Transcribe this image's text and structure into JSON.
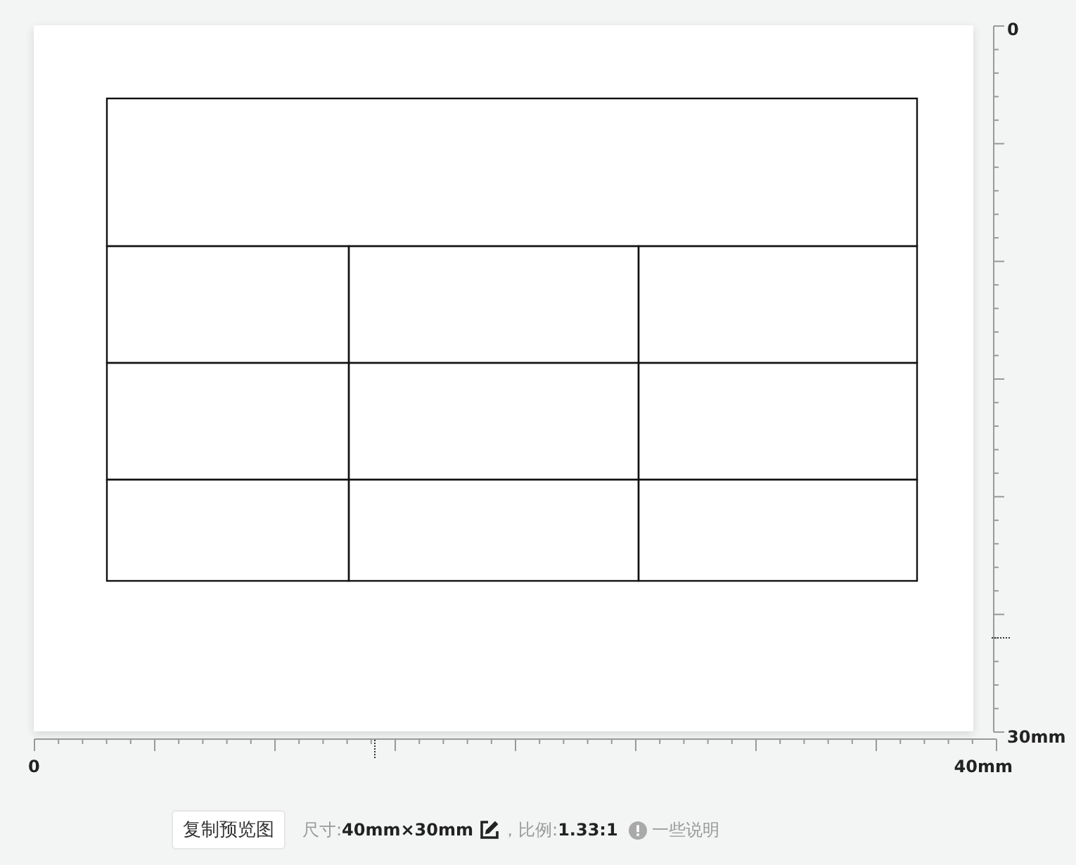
{
  "preview": {
    "table": {
      "rows": [
        {
          "kind": "full"
        },
        {
          "kind": "split"
        },
        {
          "kind": "split"
        },
        {
          "kind": "split"
        }
      ]
    }
  },
  "vertical_ruler": {
    "start_label": "0",
    "end_label": "30mm"
  },
  "horizontal_ruler": {
    "start_label": "0",
    "end_label": "40mm"
  },
  "footer": {
    "copy_button": "复制预览图",
    "size_label": "尺寸:",
    "size_value": "40mm×30mm",
    "ratio_label": "，比例:",
    "ratio_value": "1.33:1",
    "note": "一些说明"
  }
}
